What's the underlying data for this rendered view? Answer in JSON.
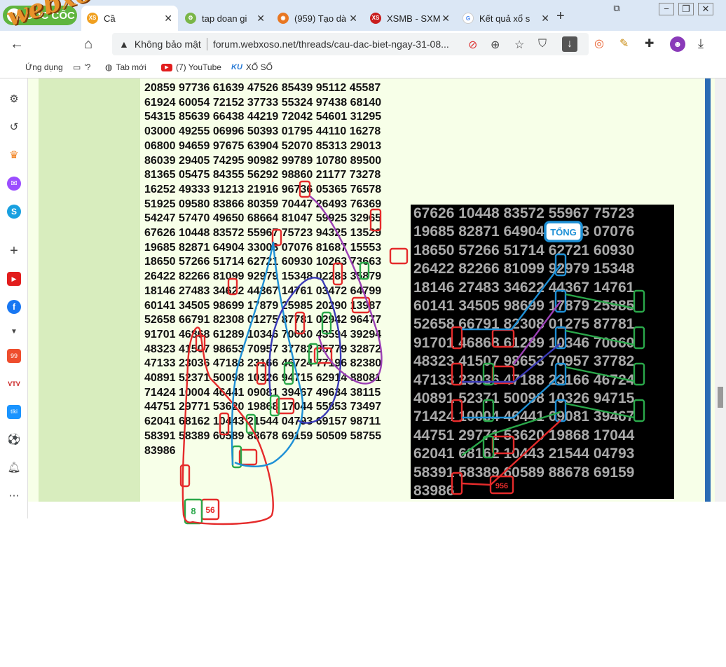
{
  "browser": {
    "brand": "CỐC CỐC",
    "tabs": [
      {
        "title": "Cầ",
        "favicon": "XS",
        "active": true
      },
      {
        "title": "tap doan gi",
        "favicon": "gear-green"
      },
      {
        "title": "(959) Tạo dà",
        "favicon": "firefox"
      },
      {
        "title": "XSMB - SXM",
        "favicon": "XS"
      },
      {
        "title": "Kết quả xổ s",
        "favicon": "google"
      }
    ],
    "security_label": "Không bảo mật",
    "url": "forum.webxoso.net/threads/cau-dac-biet-ngay-31-08..."
  },
  "bookmarks": [
    {
      "label": "Ứng dụng",
      "icon": "apps-icon"
    },
    {
      "label": "'?",
      "icon": "folder-icon"
    },
    {
      "label": "Tab mới",
      "icon": "globe-icon"
    },
    {
      "label": "(7) YouTube",
      "icon": "youtube-icon"
    },
    {
      "label": "XỔ SỐ",
      "icon": "ku-icon"
    }
  ],
  "watermark": "webxoso.net",
  "number_rows": [
    "20859 97736 61639 47526 85439 95112 45587",
    "61924 60054 72152 37733 55324 97438 68140",
    "54315 85639 66438 44219 72042 54601 31295",
    "03000 49255 06996 50393 01795 44110 16278",
    "06800 94659 97675 63904 52070 85313 29013",
    "86039 29405 74295 90982 99789 10780 89500",
    "81365 05475 84355 56292 98860 21177 73278",
    "16252 49333 91213 21916 96736 05365 76578",
    "51925 09580 83866 80359 70447 26493 76369",
    "54247 57470 49650 68664 81047 59925 32965",
    "67626 10448 83572 55967 75723 94325 13529",
    "19685 82871 64904 33003 07076 81687 15553",
    "18650 57266 51714 62721 60930 10263 73663",
    "26422 82266 81099 92979 15348 02283 35879",
    "18146 27483 34622 44367 14761 03472 64799",
    "60141 34505 98699 17879 25985 20290 13987",
    "52658 66791 82308 01275 87781 02942 96477",
    "91701 46868 61289 10346 70060 43594 39294",
    "48323 41507 98653 70957 37782 05779 32872",
    "47133 23036 47188 23166 46724 77196 82380",
    "40891 52371 50098 10326 94715 62914 88081",
    "71424 10004 46441 09081 39467 49634 38115",
    "44751 29771 53620 19868 17044 55853 73497",
    "62041 68162 10443 21544 04793 69157 98711",
    "58391 58389 60589 88678 69159 50509 58755",
    "83986"
  ],
  "bottom_labels": {
    "green": "8",
    "red": "56"
  },
  "chart": {
    "rows": [
      "67626 10448 83572 55967 75723",
      "19685 82871 64904 33003 07076",
      "18650 57266 51714 62721 60930",
      "26422 82266 81099 92979 15348",
      "18146 27483 34622 44367 14761",
      "60141 34505 98699 17879 25985",
      "52658 66791 82308 01275 87781",
      "91701 46868 61289 10346 70060",
      "48323 41507 98653 70957 37782",
      "47133 23036 47188 23166 46724",
      "40891 52371 50098 10326 94715",
      "71424 10004 46441 09081 39467",
      "44751 29771 53620 19868 17044",
      "62041 68162 10443 21544 04793",
      "58391 58389 60589 88678 69159",
      "83986"
    ],
    "tong_label": "TỔNG",
    "result_label": "956",
    "colors": {
      "red": "#e52b2b",
      "green": "#2aa84a",
      "blue": "#1e90d6",
      "purple": "#9b3fb5",
      "navy": "#3a3ab8"
    }
  }
}
